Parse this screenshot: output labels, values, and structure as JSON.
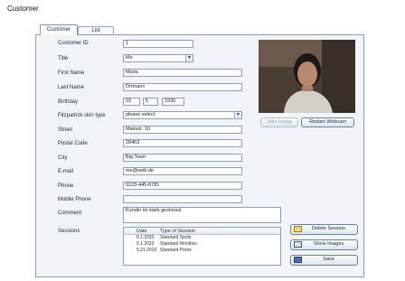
{
  "window": {
    "title": "Customer"
  },
  "tabs": [
    {
      "label": "Customer"
    },
    {
      "label": "List"
    }
  ],
  "form": {
    "customer_id": {
      "label": "Customer ID",
      "value": "1"
    },
    "title": {
      "label": "Title",
      "value": "Ms"
    },
    "first_name": {
      "label": "First Name",
      "value": "Maria"
    },
    "last_name": {
      "label": "Last Name",
      "value": "Ortmann"
    },
    "birthday": {
      "label": "Birthday",
      "day": "03",
      "month": "5",
      "year": "1936"
    },
    "skin_type": {
      "label": "Fitzpatrick skin type",
      "value": "please select"
    },
    "street": {
      "label": "Street",
      "value": "Mainstr. 10"
    },
    "postal_code": {
      "label": "Postal Code",
      "value": "28463"
    },
    "city": {
      "label": "City",
      "value": "Big Town"
    },
    "email": {
      "label": "E-mail",
      "value": "me@web.de"
    },
    "phone": {
      "label": "Phone",
      "value": "0123-445-6781"
    },
    "mobile_phone": {
      "label": "Mobile Phone",
      "value": ""
    },
    "comment": {
      "label": "Comment",
      "value": "Kundin ist stark gestresst"
    }
  },
  "webcam": {
    "take_image_label": "Take Image",
    "restart_label": "Restart Webcam"
  },
  "sessions": {
    "label": "Sessions",
    "columns": [
      "Date",
      "Type of Session"
    ],
    "rows": [
      {
        "date": "6.1.2010",
        "type": "Standard Spritz"
      },
      {
        "date": "6.1.2010",
        "type": "Standard Wrinkles"
      },
      {
        "date": "5.21.2010",
        "type": "Standard Pores"
      }
    ]
  },
  "actions": {
    "delete_session": "Delete Session",
    "show_images": "Show Images",
    "save": "Save"
  }
}
